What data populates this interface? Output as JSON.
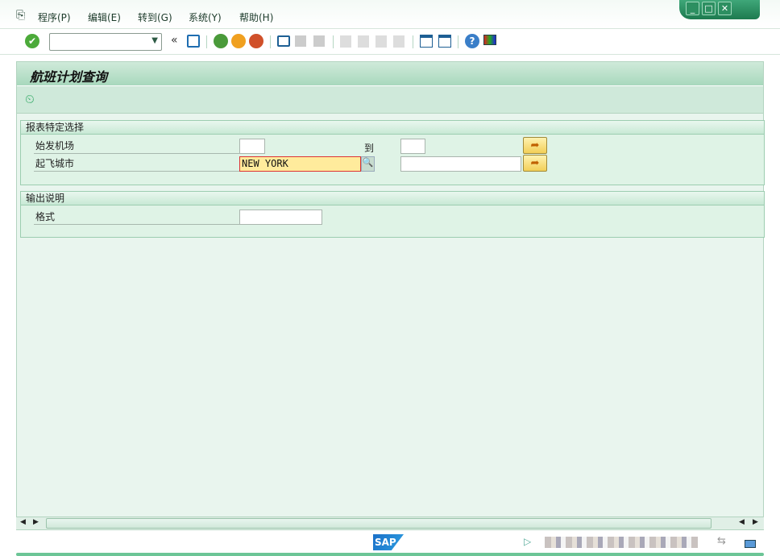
{
  "menu": [
    "程序(P)",
    "编辑(E)",
    "转到(G)",
    "系统(Y)",
    "帮助(H)"
  ],
  "window_controls": {
    "minimize": "_",
    "maximize": "□",
    "close": "✕"
  },
  "command_field": {
    "value": ""
  },
  "title": "航班计划查询",
  "selection_group": {
    "header": "报表特定选择",
    "rows": [
      {
        "label": "始发机场",
        "from": "",
        "to_label": "到",
        "to": ""
      },
      {
        "label": "起飞城市",
        "from": "NEW YORK",
        "to": ""
      }
    ]
  },
  "output_group": {
    "header": "输出说明",
    "rows": [
      {
        "label": "格式",
        "value": ""
      }
    ]
  },
  "status": {
    "logo": "SAP"
  },
  "colors": {
    "accent": "#2d8f61",
    "highlight": "#ffeb9c"
  }
}
